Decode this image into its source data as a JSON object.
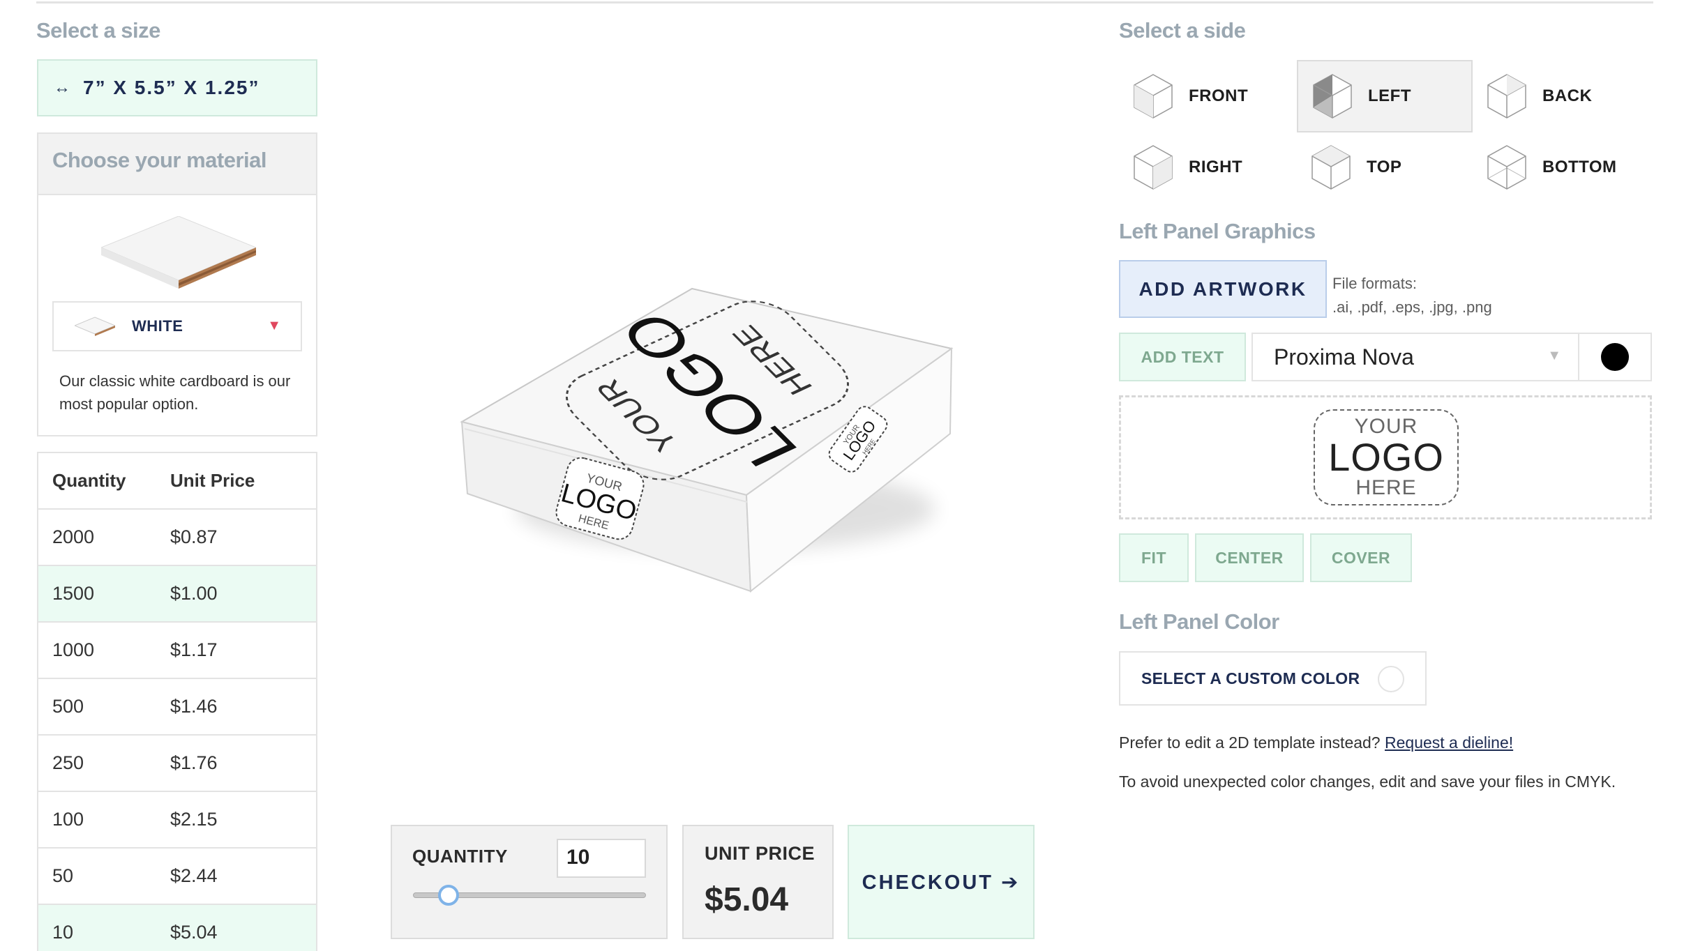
{
  "size": {
    "section_title": "Select a size",
    "arrows": "↔",
    "value": "7” X 5.5” X 1.25”"
  },
  "material": {
    "section_title": "Choose your material",
    "selected": "WHITE",
    "description": "Our classic white cardboard is our most popular option."
  },
  "price_table": {
    "headers": [
      "Quantity",
      "Unit Price"
    ],
    "rows": [
      {
        "qty": "2000",
        "price": "$0.87"
      },
      {
        "qty": "1500",
        "price": "$1.00"
      },
      {
        "qty": "1000",
        "price": "$1.17"
      },
      {
        "qty": "500",
        "price": "$1.46"
      },
      {
        "qty": "250",
        "price": "$1.76"
      },
      {
        "qty": "100",
        "price": "$2.15"
      },
      {
        "qty": "50",
        "price": "$2.44"
      },
      {
        "qty": "10",
        "price": "$5.04"
      }
    ]
  },
  "preview": {
    "logo_top": "YOUR",
    "logo_mid": "LOGO",
    "logo_bottom": "HERE"
  },
  "order": {
    "quantity_label": "QUANTITY",
    "quantity_value": "10",
    "unit_price_label": "UNIT PRICE",
    "unit_price_value": "$5.04",
    "checkout_label": "CHECKOUT ➔"
  },
  "sides": {
    "section_title": "Select a side",
    "items": [
      {
        "label": "FRONT"
      },
      {
        "label": "LEFT"
      },
      {
        "label": "BACK"
      },
      {
        "label": "RIGHT"
      },
      {
        "label": "TOP"
      },
      {
        "label": "BOTTOM"
      }
    ],
    "active": "LEFT"
  },
  "graphics": {
    "section_title": "Left Panel Graphics",
    "add_artwork": "ADD ARTWORK",
    "formats_line1": "File formats:",
    "formats_line2": ".ai, .pdf, .eps, .jpg, .png",
    "add_text": "ADD TEXT",
    "font": "Proxima Nova",
    "text_color": "#000000",
    "fit": "FIT",
    "center": "CENTER",
    "cover": "COVER"
  },
  "panel_color": {
    "section_title": "Left Panel Color",
    "select_label": "SELECT A CUSTOM COLOR"
  },
  "notes": {
    "dieline_prefix": "Prefer to edit a 2D template instead?",
    "dieline_link": "Request a dieline!",
    "cmyk": "To avoid unexpected color changes, edit and save your files in CMYK."
  },
  "colors": {
    "accent_green": "#ebfbf3",
    "accent_blue": "#e6eefa",
    "navy": "#1e2c52",
    "heading_gray": "#9aa7b1"
  }
}
